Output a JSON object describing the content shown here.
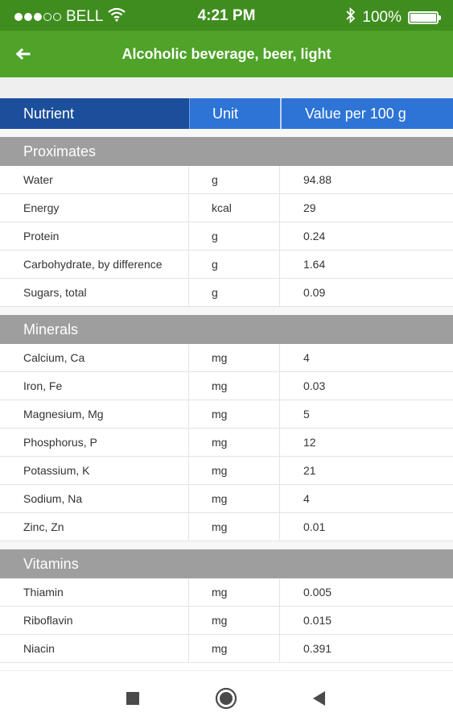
{
  "status_bar": {
    "carrier": "BELL",
    "time": "4:21 PM",
    "battery_percent": "100%",
    "signal_filled": 3,
    "signal_total": 5
  },
  "app_bar": {
    "title": "Alcoholic beverage, beer, light",
    "background_color": "#4ea328"
  },
  "table": {
    "headers": {
      "nutrient": "Nutrient",
      "unit": "Unit",
      "value": "Value per 100 g"
    },
    "sections": [
      {
        "title": "Proximates",
        "rows": [
          {
            "name": "Water",
            "unit": "g",
            "value": "94.88"
          },
          {
            "name": "Energy",
            "unit": "kcal",
            "value": "29"
          },
          {
            "name": "Protein",
            "unit": "g",
            "value": "0.24"
          },
          {
            "name": "Carbohydrate, by difference",
            "unit": "g",
            "value": "1.64"
          },
          {
            "name": "Sugars, total",
            "unit": "g",
            "value": "0.09"
          }
        ]
      },
      {
        "title": "Minerals",
        "rows": [
          {
            "name": "Calcium, Ca",
            "unit": "mg",
            "value": "4"
          },
          {
            "name": "Iron, Fe",
            "unit": "mg",
            "value": "0.03"
          },
          {
            "name": "Magnesium, Mg",
            "unit": "mg",
            "value": "5"
          },
          {
            "name": "Phosphorus, P",
            "unit": "mg",
            "value": "12"
          },
          {
            "name": "Potassium, K",
            "unit": "mg",
            "value": "21"
          },
          {
            "name": "Sodium, Na",
            "unit": "mg",
            "value": "4"
          },
          {
            "name": "Zinc, Zn",
            "unit": "mg",
            "value": "0.01"
          }
        ]
      },
      {
        "title": "Vitamins",
        "rows": [
          {
            "name": "Thiamin",
            "unit": "mg",
            "value": "0.005"
          },
          {
            "name": "Riboflavin",
            "unit": "mg",
            "value": "0.015"
          },
          {
            "name": "Niacin",
            "unit": "mg",
            "value": "0.391"
          }
        ]
      }
    ]
  },
  "nav_bar": {
    "icons": [
      "square-icon",
      "circle-home-icon",
      "back-triangle-icon"
    ]
  },
  "colors": {
    "status_bar": "#3f8d1f",
    "app_bar": "#4ea328",
    "header_dark_blue": "#1c4f9b",
    "header_blue": "#2d74d6",
    "section_gray": "#9e9e9e"
  }
}
